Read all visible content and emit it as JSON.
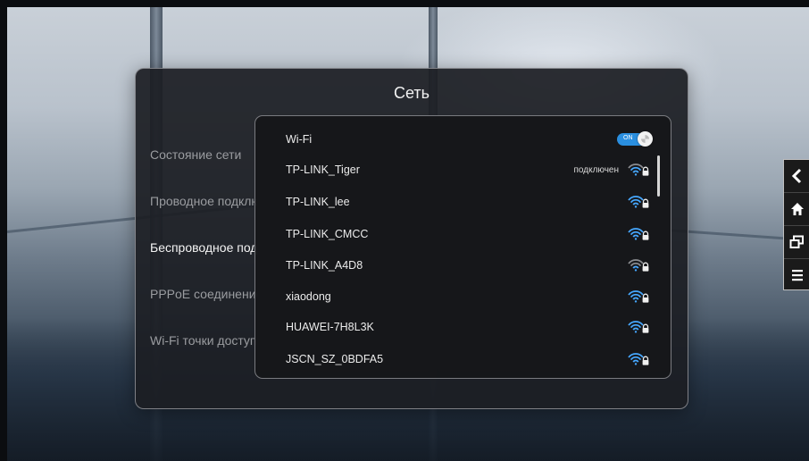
{
  "dialog": {
    "title": "Сеть"
  },
  "sidebar": {
    "items": [
      {
        "label": "Состояние сети"
      },
      {
        "label": "Проводное подключение"
      },
      {
        "label": "Беспроводное подключение"
      },
      {
        "label": "PPPoE соединение"
      },
      {
        "label": "Wi-Fi точки доступа"
      }
    ],
    "active_index": 2
  },
  "wifi": {
    "header_label": "Wi-Fi",
    "toggle_label": "ON",
    "toggle_on": true,
    "accent_color": "#2a8fe0",
    "networks": [
      {
        "name": "TP-LINK_Tiger",
        "status": "подключен",
        "signal": 2,
        "locked": true
      },
      {
        "name": "TP-LINK_lee",
        "status": "",
        "signal": 3,
        "locked": true
      },
      {
        "name": "TP-LINK_CMCC",
        "status": "",
        "signal": 3,
        "locked": true
      },
      {
        "name": "TP-LINK_A4D8",
        "status": "",
        "signal": 1,
        "locked": true
      },
      {
        "name": "xiaodong",
        "status": "",
        "signal": 3,
        "locked": true
      },
      {
        "name": "HUAWEI-7H8L3K",
        "status": "",
        "signal": 3,
        "locked": true
      },
      {
        "name": "JSCN_SZ_0BDFA5",
        "status": "",
        "signal": 3,
        "locked": true
      }
    ]
  },
  "nav": {
    "icons": [
      "back-icon",
      "home-icon",
      "windows-icon",
      "menu-icon"
    ]
  }
}
